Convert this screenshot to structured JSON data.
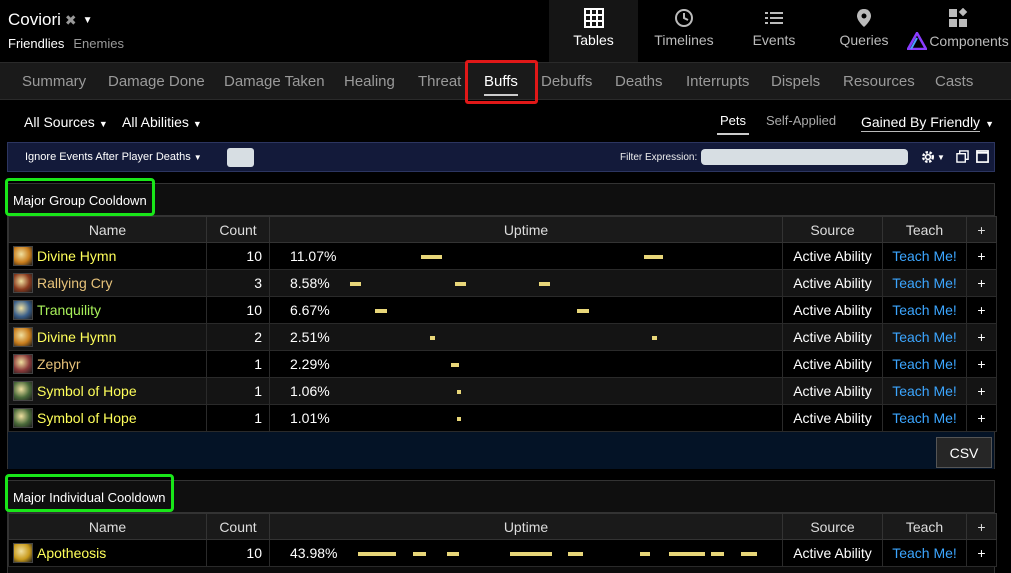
{
  "header": {
    "title": "Coviori",
    "sub_tabs": [
      "Friendlies",
      "Enemies"
    ],
    "views": [
      {
        "label": "Tables",
        "icon": "table-icon"
      },
      {
        "label": "Timelines",
        "icon": "clock-icon"
      },
      {
        "label": "Events",
        "icon": "list-icon"
      },
      {
        "label": "Queries",
        "icon": "location-pin-icon"
      },
      {
        "label": "Components",
        "icon": "components-icon"
      }
    ]
  },
  "tabs": [
    "Summary",
    "Damage Done",
    "Damage Taken",
    "Healing",
    "Threat",
    "Buffs",
    "Debuffs",
    "Deaths",
    "Interrupts",
    "Dispels",
    "Resources",
    "Casts"
  ],
  "active_tab": "Buffs",
  "filters": {
    "sources": "All Sources",
    "abilities": "All Abilities",
    "pets": "Pets",
    "self_applied": "Self-Applied",
    "gained_by": "Gained By Friendly"
  },
  "settings": {
    "ignore_deaths": "Ignore Events After Player Deaths",
    "filter_label": "Filter Expression:",
    "filter_value": ""
  },
  "columns": {
    "name": "Name",
    "count": "Count",
    "uptime": "Uptime",
    "source": "Source",
    "teach": "Teach",
    "plus": "+"
  },
  "colors": {
    "accent_bar": "#e8d679",
    "teach_link": "#3ca6ff",
    "highlight_red": "#e01818",
    "highlight_green": "#19e619",
    "settings_bg": "#131a3a"
  },
  "panels": [
    {
      "title": "Major Group Cooldown",
      "csv_label": "CSV",
      "rows": [
        {
          "name": "Divine Hymn",
          "name_color": "#ffff5a",
          "icon": "divine-hymn-icon",
          "icon_color": "#c87c1c",
          "count": "10",
          "uptime": "11.07%",
          "segments": [
            [
              0.17,
              0.05
            ],
            [
              0.7,
              0.045
            ]
          ],
          "source": "Active Ability",
          "teach": "Teach Me!",
          "plus": "+"
        },
        {
          "name": "Rallying Cry",
          "name_color": "#e6c27a",
          "icon": "rallying-cry-icon",
          "icon_color": "#8a3a1e",
          "count": "3",
          "uptime": "8.58%",
          "segments": [
            [
              0.0,
              0.025
            ],
            [
              0.25,
              0.025
            ],
            [
              0.45,
              0.025
            ]
          ],
          "source": "Active Ability",
          "teach": "Teach Me!",
          "plus": "+"
        },
        {
          "name": "Tranquility",
          "name_color": "#a8f05a",
          "icon": "tranquility-icon",
          "icon_color": "#3a5f8a",
          "count": "10",
          "uptime": "6.67%",
          "segments": [
            [
              0.06,
              0.028
            ],
            [
              0.54,
              0.028
            ]
          ],
          "source": "Active Ability",
          "teach": "Teach Me!",
          "plus": "+"
        },
        {
          "name": "Divine Hymn",
          "name_color": "#ffff5a",
          "icon": "divine-hymn-icon",
          "icon_color": "#c87c1c",
          "count": "2",
          "uptime": "2.51%",
          "segments": [
            [
              0.19,
              0.012
            ],
            [
              0.72,
              0.012
            ]
          ],
          "source": "Active Ability",
          "teach": "Teach Me!",
          "plus": "+"
        },
        {
          "name": "Zephyr",
          "name_color": "#e6c27a",
          "icon": "zephyr-icon",
          "icon_color": "#8a3a3a",
          "count": "1",
          "uptime": "2.29%",
          "segments": [
            [
              0.24,
              0.02
            ]
          ],
          "source": "Active Ability",
          "teach": "Teach Me!",
          "plus": "+"
        },
        {
          "name": "Symbol of Hope",
          "name_color": "#ffff5a",
          "icon": "symbol-of-hope-icon",
          "icon_color": "#4a6a3a",
          "count": "1",
          "uptime": "1.06%",
          "segments": [
            [
              0.255,
              0.008
            ]
          ],
          "source": "Active Ability",
          "teach": "Teach Me!",
          "plus": "+"
        },
        {
          "name": "Symbol of Hope",
          "name_color": "#ffff5a",
          "icon": "symbol-of-hope-icon",
          "icon_color": "#4a6a3a",
          "count": "1",
          "uptime": "1.01%",
          "segments": [
            [
              0.255,
              0.008
            ]
          ],
          "source": "Active Ability",
          "teach": "Teach Me!",
          "plus": "+"
        }
      ]
    },
    {
      "title": "Major Individual Cooldown",
      "rows": [
        {
          "name": "Apotheosis",
          "name_color": "#ffff5a",
          "icon": "apotheosis-icon",
          "icon_color": "#c89a1c",
          "count": "10",
          "uptime": "43.98%",
          "segments": [
            [
              0.02,
              0.09
            ],
            [
              0.15,
              0.03
            ],
            [
              0.23,
              0.03
            ],
            [
              0.38,
              0.1
            ],
            [
              0.52,
              0.035
            ],
            [
              0.69,
              0.025
            ],
            [
              0.76,
              0.085
            ],
            [
              0.86,
              0.03
            ],
            [
              0.93,
              0.04
            ]
          ],
          "source": "Active Ability",
          "teach": "Teach Me!",
          "plus": "+"
        }
      ]
    }
  ]
}
